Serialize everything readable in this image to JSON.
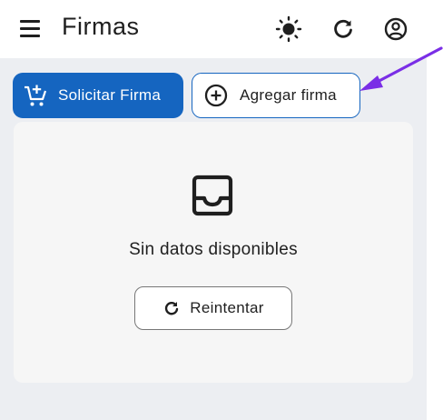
{
  "app_bar": {
    "title": "Firmas",
    "icons": [
      "menu-icon",
      "sun-icon",
      "refresh-icon",
      "account-circle-icon"
    ]
  },
  "actions": {
    "request_signature_label": "Solicitar Firma",
    "add_signature_label": "Agregar firma"
  },
  "empty_state": {
    "message": "Sin datos disponibles",
    "retry_label": "Reintentar",
    "icon": "inbox-icon"
  },
  "colors": {
    "primary": "#1565c0",
    "content_bg": "#eceef2",
    "card_bg": "#f6f6f6",
    "annotation_arrow": "#7a2ee6"
  }
}
